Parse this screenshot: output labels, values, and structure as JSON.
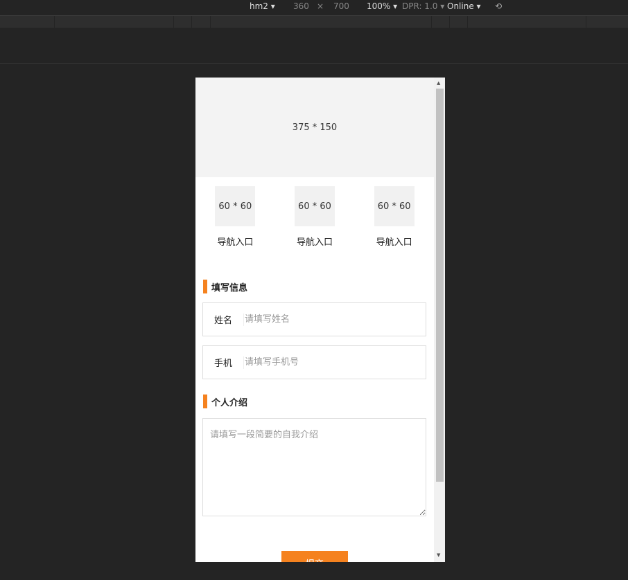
{
  "toolbar": {
    "device": "hm2",
    "width": "360",
    "times": "×",
    "height": "700",
    "zoom": "100%",
    "dpr": "DPR: 1.0",
    "network": "Online",
    "rotate_icon": "rotate-icon"
  },
  "banner": {
    "text": "375 * 150"
  },
  "nav": [
    {
      "img": "60 * 60",
      "label": "导航入口"
    },
    {
      "img": "60 * 60",
      "label": "导航入口"
    },
    {
      "img": "60 * 60",
      "label": "导航入口"
    }
  ],
  "form": {
    "section1": "填写信息",
    "name": {
      "label": "姓名",
      "placeholder": "请填写姓名",
      "value": ""
    },
    "phone": {
      "label": "手机",
      "placeholder": "请填写手机号",
      "value": ""
    },
    "section2": "个人介绍",
    "intro": {
      "placeholder": "请填写一段简要的自我介绍",
      "value": ""
    },
    "submit": "提交"
  },
  "colors": {
    "accent": "#f5821f"
  }
}
